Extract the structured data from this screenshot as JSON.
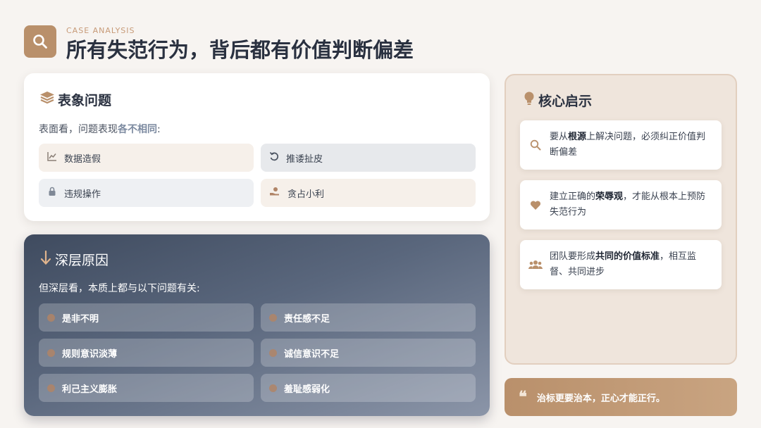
{
  "header": {
    "icon": "search-icon",
    "subtitle": "CASE ANALYSIS",
    "title": "所有失范行为，背后都有价值判断偏差"
  },
  "surface": {
    "icon": "layers-icon",
    "title": "表象问题",
    "lead_prefix": "表面看，问题表现",
    "lead_highlight": "各不相同",
    "lead_suffix": ":",
    "items": [
      {
        "icon": "chart-line-icon",
        "label": "数据造假"
      },
      {
        "icon": "rotate-icon",
        "label": "推诿扯皮"
      },
      {
        "icon": "lock-icon",
        "label": "违规操作"
      },
      {
        "icon": "hand-coin-icon",
        "label": "贪占小利"
      }
    ]
  },
  "deep": {
    "icon": "arrow-down-icon",
    "title": "深层原因",
    "lead": "但深层看，本质上都与以下问题有关:",
    "items": [
      "是非不明",
      "责任感不足",
      "规则意识淡薄",
      "诚信意识不足",
      "利己主义膨胀",
      "羞耻感弱化"
    ]
  },
  "insight": {
    "icon": "lightbulb-icon",
    "title": "核心启示",
    "cards": [
      {
        "icon": "search-icon",
        "pre": "要从",
        "bold": "根源",
        "post": "上解决问题，必须纠正价值判断偏差"
      },
      {
        "icon": "heart-icon",
        "pre": "建立正确的",
        "bold": "荣辱观",
        "post": "，才能从根本上预防失范行为"
      },
      {
        "icon": "users-icon",
        "pre": "团队要形成",
        "bold": "共同的价值标准",
        "post": "，相互监督、共同进步"
      }
    ]
  },
  "quote": {
    "icon": "quote-icon",
    "text": "治标更要治本，正心才能正行。"
  },
  "colors": {
    "accent": "#b9906b",
    "dark": "#2a3140",
    "deep_bg": "#4d5a70"
  }
}
